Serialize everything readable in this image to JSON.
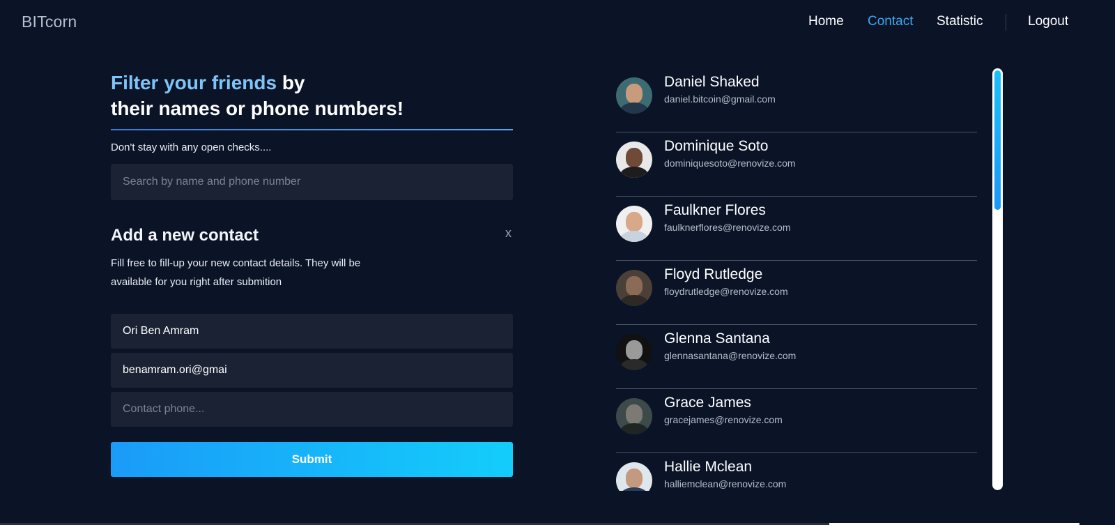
{
  "header": {
    "logo": "BITcorn",
    "nav": [
      {
        "label": "Home",
        "active": false
      },
      {
        "label": "Contact",
        "active": true
      },
      {
        "label": "Statistic",
        "active": false
      }
    ],
    "logout": "Logout"
  },
  "filter": {
    "headline_highlight": "Filter your friends",
    "headline_rest1": " by",
    "headline_line2": "their names or phone numbers!",
    "subtitle": "Don't stay with any open checks....",
    "search_placeholder": "Search by name and phone number"
  },
  "add_contact": {
    "title": "Add a new contact",
    "close": "x",
    "description": "Fill free to fill-up your new contact details. They will be available for you right after submition",
    "name_value": "Ori Ben Amram",
    "email_value": "benamram.ori@gmai",
    "phone_placeholder": "Contact phone...",
    "submit": "Submit"
  },
  "contacts": [
    {
      "name": "Daniel Shaked",
      "email": "daniel.bitcoin@gmail.com"
    },
    {
      "name": "Dominique Soto",
      "email": "dominiquesoto@renovize.com"
    },
    {
      "name": "Faulkner Flores",
      "email": "faulknerflores@renovize.com"
    },
    {
      "name": "Floyd Rutledge",
      "email": "floydrutledge@renovize.com"
    },
    {
      "name": "Glenna Santana",
      "email": "glennasantana@renovize.com"
    },
    {
      "name": "Grace James",
      "email": "gracejames@renovize.com"
    },
    {
      "name": "Hallie Mclean",
      "email": "halliemclean@renovize.com"
    }
  ],
  "colors": {
    "background": "#0b1327",
    "accent": "#3ea7f0",
    "highlight": "#7ec4f7",
    "field_bg": "#1a2233"
  }
}
